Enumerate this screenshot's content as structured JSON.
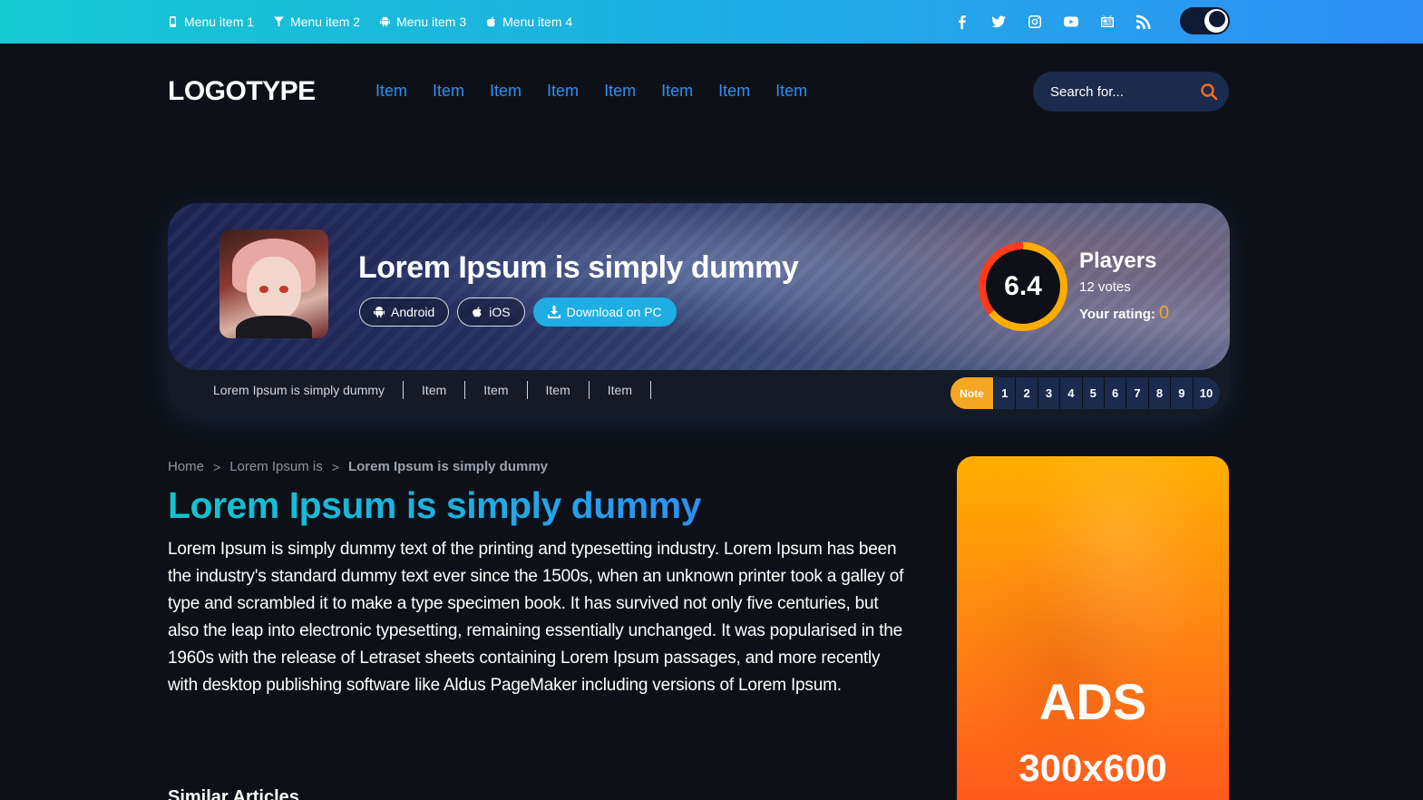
{
  "topbar": {
    "menu": [
      {
        "label": "Menu item 1",
        "icon": "phone-icon"
      },
      {
        "label": "Menu item 2",
        "icon": "filter-icon"
      },
      {
        "label": "Menu item 3",
        "icon": "android-icon"
      },
      {
        "label": "Menu item 4",
        "icon": "apple-icon"
      }
    ],
    "socials": [
      "facebook-icon",
      "twitter-icon",
      "instagram-icon",
      "youtube-icon",
      "news-icon",
      "rss-icon"
    ],
    "theme_toggle": "dark-mode"
  },
  "header": {
    "logo": "LOGOTYPE",
    "nav": [
      "Item",
      "Item",
      "Item",
      "Item",
      "Item",
      "Item",
      "Item",
      "Item"
    ],
    "search_placeholder": "Search for..."
  },
  "hero": {
    "title": "Lorem Ipsum is simply dummy",
    "buttons": {
      "android": "Android",
      "ios": "iOS",
      "download": "Download on PC"
    },
    "score": "6.4",
    "score_fraction": 0.64,
    "players_label": "Players",
    "votes": "12 votes",
    "your_rating_label": "Your rating:",
    "your_rating_value": "0",
    "subnav": [
      "Lorem Ipsum is simply dummy",
      "Item",
      "Item",
      "Item",
      "Item"
    ],
    "rating_note": "Note",
    "rating_numbers": [
      "1",
      "2",
      "3",
      "4",
      "5",
      "6",
      "7",
      "8",
      "9",
      "10"
    ]
  },
  "breadcrumb": {
    "home": "Home",
    "parent": "Lorem Ipsum is",
    "current": "Lorem Ipsum is simply dummy",
    "separator": ">"
  },
  "article": {
    "title": "Lorem Ipsum is simply dummy",
    "body": "Lorem Ipsum is simply dummy text of the printing and typesetting industry. Lorem Ipsum has been the industry's standard dummy text ever since the 1500s, when an unknown printer took a galley of type and scrambled it to make a type specimen book. It has survived not only five centuries, but also the leap into electronic typesetting, remaining essentially unchanged. It was popularised in the 1960s with the release of Letraset sheets containing Lorem Ipsum passages, and more recently with desktop publishing software like Aldus PageMaker including versions of Lorem Ipsum.",
    "similar_title": "Similar Articles"
  },
  "ad": {
    "title": "ADS",
    "size": "300x600"
  },
  "colors": {
    "accent_blue": "#2f8ff5",
    "accent_cyan": "#15c8d0",
    "accent_orange": "#f5a623",
    "background": "#0d1117"
  }
}
